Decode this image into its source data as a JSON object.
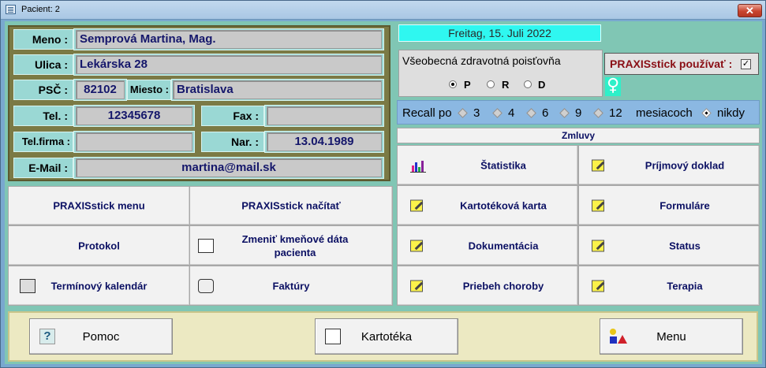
{
  "window": {
    "title": "Pacient: 2",
    "close_glyph": "✕"
  },
  "patient": {
    "name_label": "Meno :",
    "name": "Semprová Martina, Mag.",
    "street_label": "Ulica :",
    "street": "Lekárska 28",
    "zip_label": "PSČ :",
    "zip": "82102",
    "city_label": "Miesto :",
    "city": "Bratislava",
    "phone_label": "Tel. :",
    "phone": "12345678",
    "fax_label": "Fax :",
    "fax": "",
    "work_phone_label": "Tel.firma :",
    "work_phone": "",
    "birth_label": "Nar. :",
    "birth": "13.04.1989",
    "email_label": "E-Mail :",
    "email": "martina@mail.sk"
  },
  "date": "Freitag, 15. Juli 2022",
  "insurer": {
    "name": "Všeobecná zdravotná poisťovňa",
    "options": [
      "P",
      "R",
      "D"
    ],
    "selected": "P"
  },
  "praxis_toggle": {
    "label": "PRAXISstick používať :",
    "checked": true,
    "check_glyph": "✓"
  },
  "gender_icon": "female-icon",
  "gender_glyph": "♀",
  "recall": {
    "label": "Recall po",
    "options": [
      "3",
      "4",
      "6",
      "9",
      "12"
    ],
    "unit": "mesiacoch",
    "never_label": "nikdy",
    "selected": "nikdy"
  },
  "left_buttons": {
    "praxis_menu": "PRAXISstick menu",
    "praxis_load": "PRAXISstick načítať",
    "protocol": "Protokol",
    "change_data": "Zmeniť kmeňové dáta pacienta",
    "calendar": "Termínový kalendár",
    "invoices": "Faktúry"
  },
  "contracts": {
    "header": "Zmluvy",
    "statistics": "Štatistika",
    "receipt": "Príjmový doklad",
    "card": "Kartotéková karta",
    "forms": "Formuláre",
    "documentation": "Dokumentácia",
    "status": "Status",
    "course": "Priebeh choroby",
    "therapy": "Terapia"
  },
  "bottom": {
    "help": "Pomoc",
    "help_glyph": "?",
    "files": "Kartotéka",
    "menu": "Menu"
  },
  "colors": {
    "accent_text": "#0b1063",
    "praxis_red": "#8a0f15",
    "date_bg": "#2ff7f0",
    "panel_bg": "#80c6b4"
  }
}
